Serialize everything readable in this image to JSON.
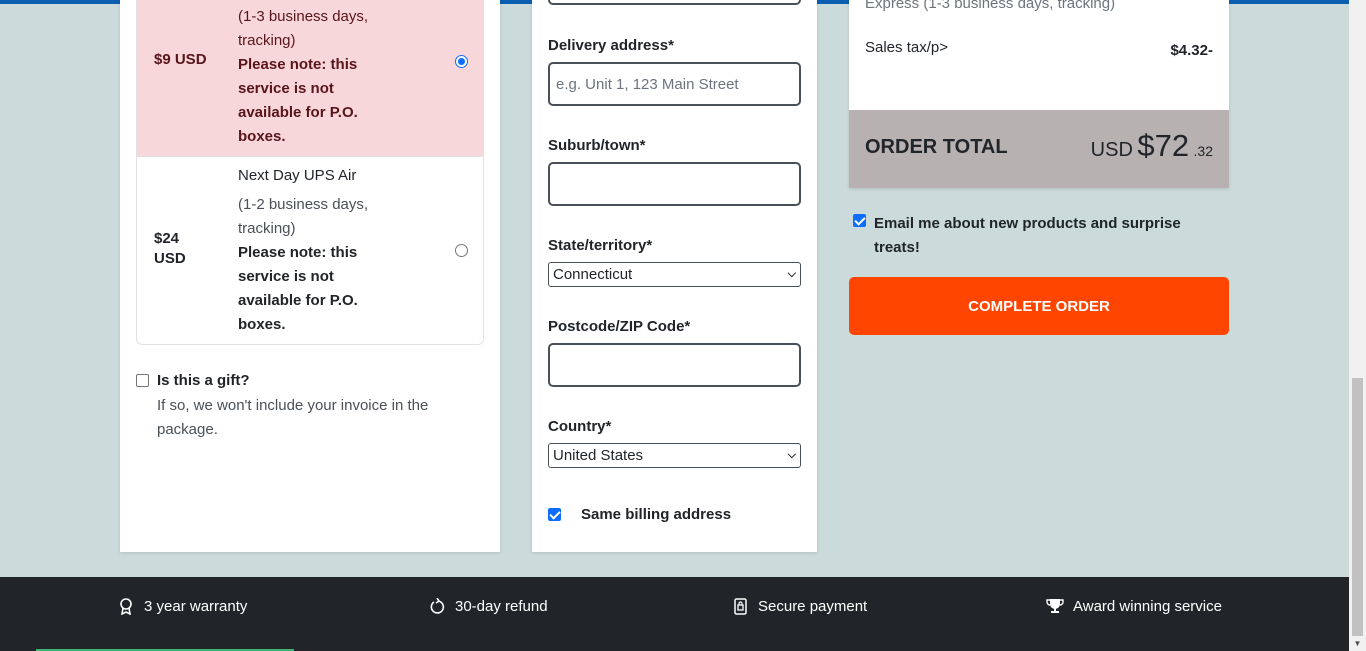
{
  "shipping": {
    "options": [
      {
        "price": "$9 USD",
        "name": "",
        "eta_lines": [
          "(1-3 business days,",
          "tracking)"
        ],
        "note_lines": [
          "Please note: this",
          "service is not",
          "available for P.O.",
          "boxes."
        ],
        "selected": true
      },
      {
        "price_lines": [
          "$24",
          "USD"
        ],
        "name": "Next Day UPS Air",
        "eta_lines": [
          "(1-2 business days,",
          "tracking)"
        ],
        "note_lines": [
          "Please note: this",
          "service is not",
          "available for P.O.",
          "boxes."
        ],
        "selected": false
      }
    ],
    "gift_label": "Is this a gift?",
    "gift_help": "If so, we won't include your invoice in the package.",
    "gift_checked": false
  },
  "address": {
    "delivery_label": "Delivery address*",
    "delivery_placeholder": "e.g. Unit 1, 123 Main Street",
    "suburb_label": "Suburb/town*",
    "suburb_value": "",
    "state_label": "State/territory*",
    "state_value": "Connecticut",
    "postcode_label": "Postcode/ZIP Code*",
    "postcode_value": "",
    "country_label": "Country*",
    "country_value": "United States",
    "same_billing_label": "Same billing address",
    "same_billing_checked": true
  },
  "summary": {
    "faded_line": "Express (1-3 business days, tracking)",
    "tax_label": "Sales tax/p>",
    "tax_value": "$4.32-",
    "total_label": "ORDER TOTAL",
    "total_currency": "USD",
    "total_amount": "$72",
    "total_cents": ".32",
    "email_opt_label": "Email me about new products and surprise treats!",
    "email_opt_checked": true,
    "complete_button": "COMPLETE ORDER"
  },
  "footer": {
    "items": [
      {
        "icon": "award-icon",
        "label": "3 year warranty"
      },
      {
        "icon": "refresh-icon",
        "label": "30-day refund"
      },
      {
        "icon": "lock-icon",
        "label": "Secure payment"
      },
      {
        "icon": "trophy-icon",
        "label": "Award winning service"
      }
    ]
  },
  "colors": {
    "accent_button": "#ff4500",
    "selected_row": "#f8d7da",
    "total_bar": "#b7b1b1",
    "footer": "#212529",
    "page_bg": "#cbdada"
  }
}
